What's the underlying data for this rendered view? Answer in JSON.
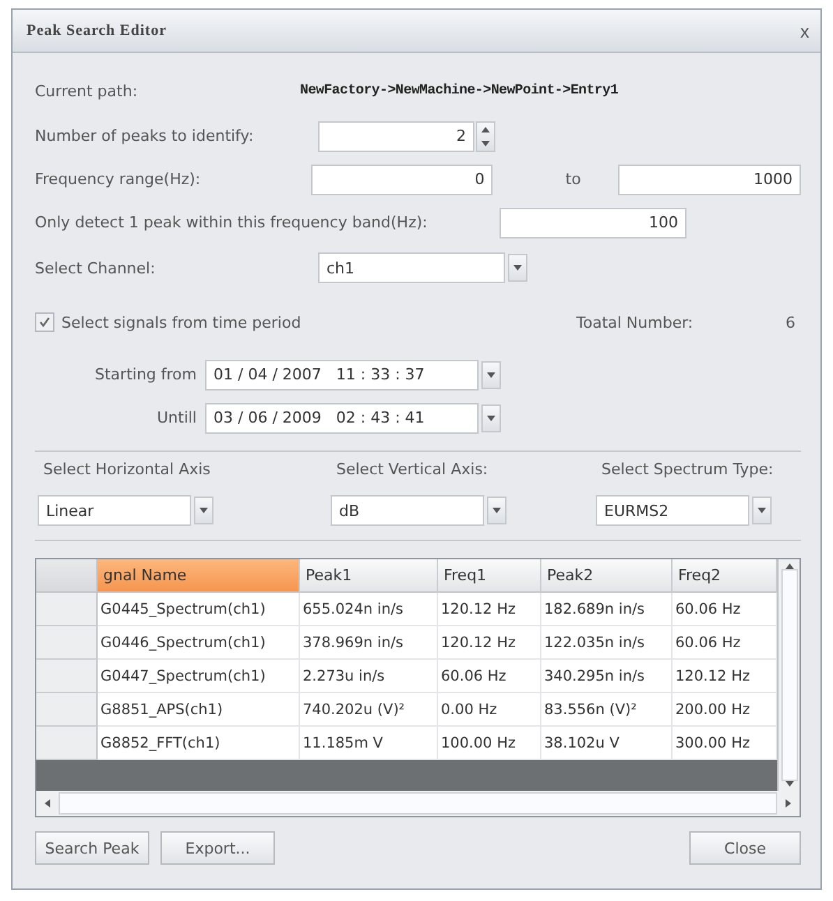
{
  "window": {
    "title": "Peak Search Editor",
    "close": "x"
  },
  "path": {
    "label": "Current path:",
    "value": "NewFactory->NewMachine->NewPoint->Entry1"
  },
  "peaks": {
    "label": "Number of peaks to identify:",
    "value": "2"
  },
  "range": {
    "label": "Frequency range(Hz):",
    "from": "0",
    "separator": "to",
    "to": "1000"
  },
  "band": {
    "label": "Only detect 1 peak within this frequency band(Hz):",
    "value": "100"
  },
  "channel": {
    "label": "Select Channel:",
    "value": "ch1"
  },
  "time_period": {
    "label": "Select signals from time period",
    "checked": true
  },
  "total": {
    "label": "Toatal Number:",
    "value": "6"
  },
  "start": {
    "label": "Starting from",
    "value": "01 / 04 / 2007   11 : 33 : 37"
  },
  "until": {
    "label": "Untill",
    "value": "03 / 06 / 2009   02 : 43 : 41"
  },
  "axes": [
    {
      "label": "Select Horizontal Axis",
      "value": "Linear"
    },
    {
      "label": "Select Vertical Axis:",
      "value": "dB"
    },
    {
      "label": "Select Spectrum Type:",
      "value": "EURMS2"
    }
  ],
  "table": {
    "columns": [
      {
        "label": "gnal Name",
        "selected": true
      },
      {
        "label": "Peak1",
        "selected": false
      },
      {
        "label": "Freq1",
        "selected": false
      },
      {
        "label": "Peak2",
        "selected": false
      },
      {
        "label": "Freq2",
        "selected": false
      }
    ],
    "rows": [
      [
        "G0445_Spectrum(ch1)",
        "655.024n in/s",
        "120.12 Hz",
        "182.689n in/s",
        "60.06 Hz"
      ],
      [
        "G0446_Spectrum(ch1)",
        "378.969n in/s",
        "120.12 Hz",
        "122.035n in/s",
        "60.06 Hz"
      ],
      [
        "G0447_Spectrum(ch1)",
        "2.273u in/s",
        "60.06 Hz",
        "340.295n in/s",
        "120.12 Hz"
      ],
      [
        "G8851_APS(ch1)",
        "740.202u (V)²",
        "0.00 Hz",
        "83.556n (V)²",
        "200.00 Hz"
      ],
      [
        "G8852_FFT(ch1)",
        "11.185m V",
        "100.00 Hz",
        "38.102u V",
        "300.00 Hz"
      ]
    ]
  },
  "buttons": {
    "left": [
      "Search Peak",
      "Export..."
    ],
    "right": "Close"
  }
}
